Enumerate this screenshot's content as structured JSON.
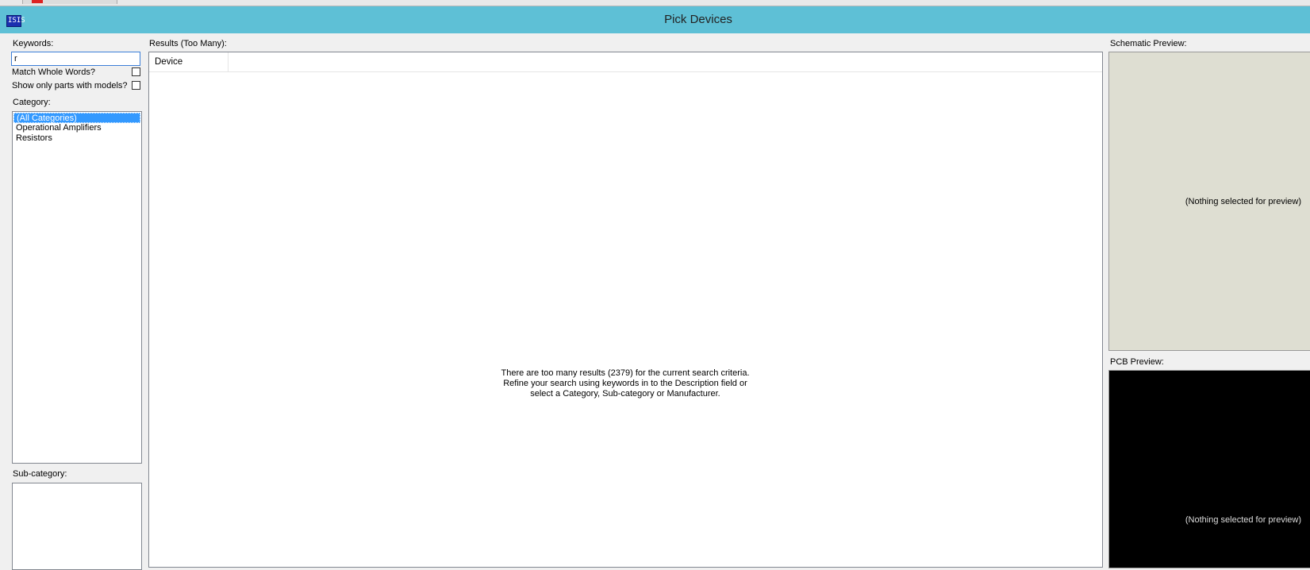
{
  "window": {
    "title": "Pick Devices",
    "app_icon_text": "ISIS"
  },
  "left_panel": {
    "keywords_label": "Keywords:",
    "keywords_value": "r",
    "match_whole_words_label": "Match Whole Words?",
    "show_only_models_label": "Show only parts with models?",
    "category_label": "Category:",
    "categories": [
      "(All Categories)",
      "Operational Amplifiers",
      "Resistors"
    ],
    "selected_category": "(All Categories)",
    "subcategory_label": "Sub-category:"
  },
  "results": {
    "label": "Results (Too Many):",
    "column_device": "Device",
    "message_line1": "There are too many results (2379) for the current search criteria.",
    "message_line2": "Refine your search using keywords in to the Description field or",
    "message_line3": "select a Category, Sub-category or Manufacturer."
  },
  "schematic_preview": {
    "label": "Schematic Preview:",
    "placeholder": "(Nothing selected for preview)"
  },
  "pcb_preview": {
    "label": "PCB Preview:",
    "placeholder": "(Nothing selected for preview)"
  },
  "colors": {
    "titlebar": "#5ec0d6",
    "selection": "#3399ff",
    "schematic_bg": "#deded2",
    "pcb_bg": "#000000"
  }
}
